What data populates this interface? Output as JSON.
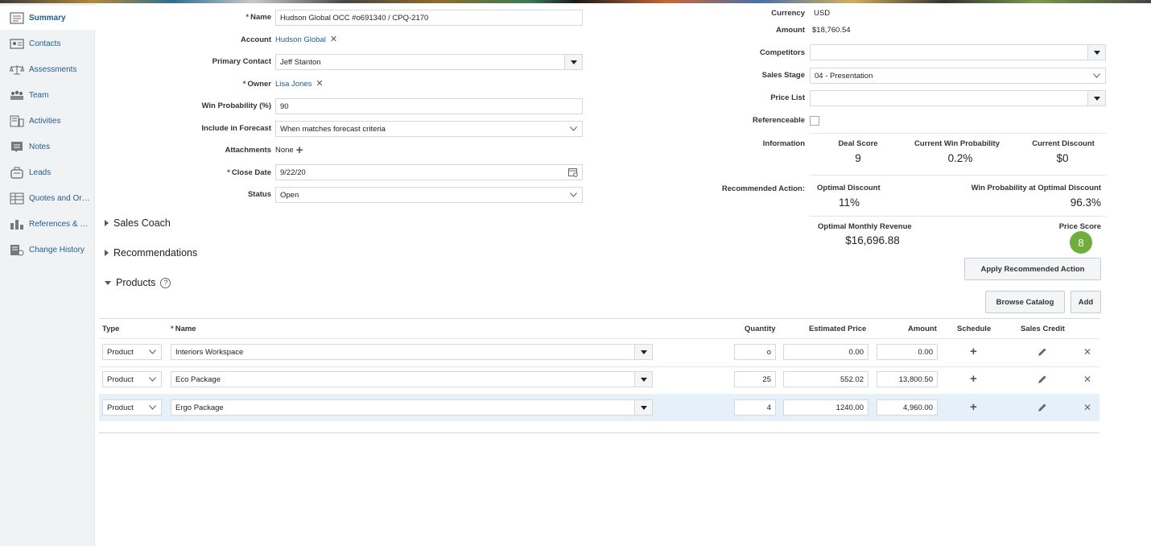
{
  "sidebar": {
    "items": [
      {
        "label": "Summary",
        "icon": "summary-icon"
      },
      {
        "label": "Contacts",
        "icon": "contacts-icon"
      },
      {
        "label": "Assessments",
        "icon": "assessments-icon"
      },
      {
        "label": "Team",
        "icon": "team-icon"
      },
      {
        "label": "Activities",
        "icon": "activities-icon"
      },
      {
        "label": "Notes",
        "icon": "notes-icon"
      },
      {
        "label": "Leads",
        "icon": "leads-icon"
      },
      {
        "label": "Quotes and Ord...",
        "icon": "quotes-icon"
      },
      {
        "label": "References & C...",
        "icon": "references-icon"
      },
      {
        "label": "Change History",
        "icon": "change-history-icon"
      }
    ]
  },
  "form": {
    "name_label": "Name",
    "name_value": "Hudson Global OCC #o691340 / CPQ-2170",
    "account_label": "Account",
    "account_value": "Hudson Global",
    "primary_contact_label": "Primary Contact",
    "primary_contact_value": "Jeff Stanton",
    "owner_label": "Owner",
    "owner_value": "Lisa Jones",
    "win_prob_label": "Win Probability (%)",
    "win_prob_value": "90",
    "forecast_label": "Include in Forecast",
    "forecast_value": "When matches forecast criteria",
    "attachments_label": "Attachments",
    "attachments_value": "None",
    "close_date_label": "Close Date",
    "close_date_value": "9/22/20",
    "status_label": "Status",
    "status_value": "Open"
  },
  "right": {
    "currency_label": "Currency",
    "currency_value": "USD",
    "amount_label": "Amount",
    "amount_value": "$18,760.54",
    "competitors_label": "Competitors",
    "competitors_value": "",
    "sales_stage_label": "Sales Stage",
    "sales_stage_value": "04 - Presentation",
    "price_list_label": "Price List",
    "price_list_value": "",
    "referenceable_label": "Referenceable",
    "information_label": "Information",
    "deal_score_label": "Deal Score",
    "deal_score_value": "9",
    "current_win_prob_label": "Current Win Probability",
    "current_win_prob_value": "0.2%",
    "current_discount_label": "Current Discount",
    "current_discount_value": "$0",
    "recommended_action_label": "Recommended Action:",
    "optimal_discount_label": "Optimal Discount",
    "optimal_discount_value": "11%",
    "win_prob_optimal_label": "Win Probability at Optimal Discount",
    "win_prob_optimal_value": "96.3%",
    "optimal_revenue_label": "Optimal Monthly Revenue",
    "optimal_revenue_value": "$16,696.88",
    "price_score_label": "Price Score",
    "price_score_value": "8",
    "apply_button": "Apply Recommended Action"
  },
  "sections": {
    "sales_coach": "Sales Coach",
    "recommendations": "Recommendations",
    "products": "Products",
    "help_glyph": "?"
  },
  "products": {
    "browse_button": "Browse Catalog",
    "add_button": "Add",
    "columns": {
      "type": "Type",
      "name": "Name",
      "quantity": "Quantity",
      "estimated_price": "Estimated Price",
      "amount": "Amount",
      "schedule": "Schedule",
      "sales_credit": "Sales Credit"
    },
    "rows": [
      {
        "type": "Product",
        "name": "Interiors Workspace",
        "quantity": "o",
        "price": "0.00",
        "amount": "0.00"
      },
      {
        "type": "Product",
        "name": "Eco Package",
        "quantity": "25",
        "price": "552.02",
        "amount": "13,800.50"
      },
      {
        "type": "Product",
        "name": "Ergo Package",
        "quantity": "4",
        "price": "1240.00",
        "amount": "4,960.00"
      }
    ]
  },
  "colors": {
    "accent": "#1d5d90",
    "score_green": "#6fae3e",
    "selected_row": "#e6f0f8"
  }
}
